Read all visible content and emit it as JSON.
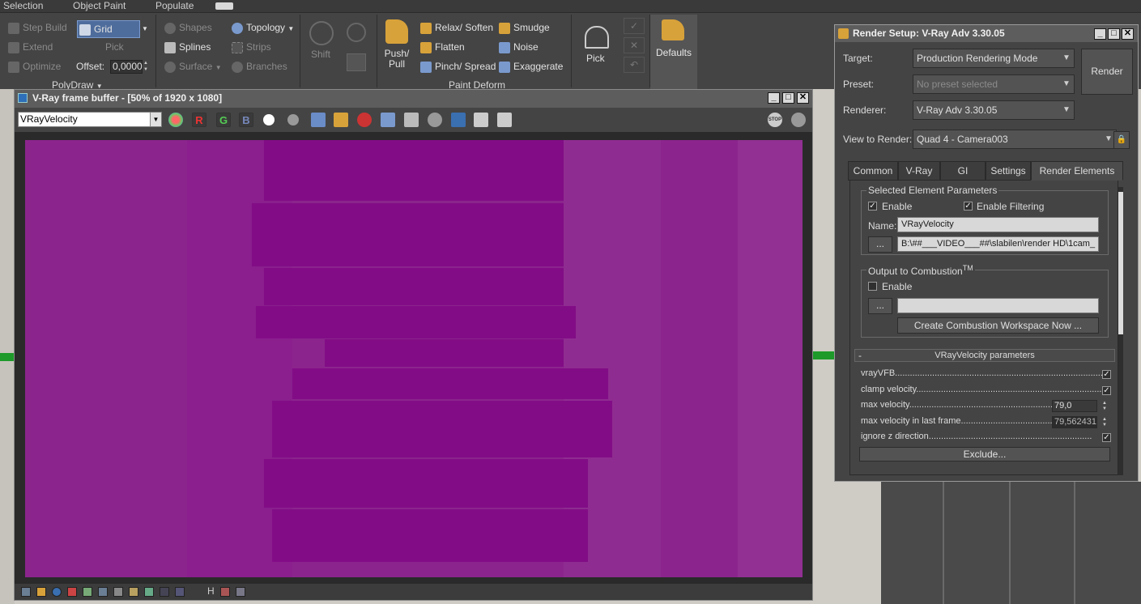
{
  "ribbon": {
    "tabs": [
      "Selection",
      "Object Paint",
      "Populate"
    ],
    "polymodeling": {
      "step_build": "Step Build",
      "extend": "Extend",
      "optimize": "Optimize",
      "grid": "Grid",
      "pick": "Pick",
      "offset_label": "Offset:",
      "offset_value": "0,0000",
      "group_title": "PolyDraw"
    },
    "draw": {
      "shapes": "Shapes",
      "splines": "Splines",
      "surface": "Surface",
      "topology": "Topology",
      "strips": "Strips",
      "branches": "Branches"
    },
    "shift": "Shift",
    "paint_deform": {
      "push_pull": "Push/\nPull",
      "relax_soften": "Relax/ Soften",
      "flatten": "Flatten",
      "pinch_spread": "Pinch/ Spread",
      "smudge": "Smudge",
      "noise": "Noise",
      "exaggerate": "Exaggerate",
      "group_title": "Paint Deform"
    },
    "pick": "Pick",
    "defaults": "Defaults"
  },
  "vfb": {
    "title": "V-Ray frame buffer - [50% of 1920 x 1080]",
    "channel": "VRayVelocity",
    "channel_buttons": [
      "R",
      "G",
      "B"
    ],
    "render_color": "#8c238e",
    "status_icons": [
      "H"
    ]
  },
  "render_setup": {
    "title": "Render Setup: V-Ray Adv 3.30.05",
    "target_label": "Target:",
    "target_value": "Production Rendering Mode",
    "preset_label": "Preset:",
    "preset_value": "No preset selected",
    "renderer_label": "Renderer:",
    "renderer_value": "V-Ray Adv 3.30.05",
    "view_label": "View to Render:",
    "view_value": "Quad 4 - Camera003",
    "render_button": "Render",
    "tabs": [
      "Common",
      "V-Ray",
      "GI",
      "Settings",
      "Render Elements"
    ],
    "selected_element": {
      "group_title": "Selected Element Parameters",
      "enable": "Enable",
      "enable_filtering": "Enable Filtering",
      "name_label": "Name:",
      "name_value": "VRayVelocity",
      "browse": "...",
      "path_value": "B:\\##___VIDEO___##\\slabilen\\render HD\\1cam_"
    },
    "combustion": {
      "group_title": "Output to Combustion",
      "tm": "TM",
      "enable": "Enable",
      "browse": "...",
      "path_value": "",
      "create_button": "Create Combustion Workspace Now ..."
    },
    "velocity_params": {
      "rollout_toggle": "-",
      "rollout_title": "VRayVelocity parameters",
      "rows": [
        {
          "label": "vrayVFB...........................................................................................",
          "type": "check",
          "checked": true
        },
        {
          "label": "clamp velocity............................................................................",
          "type": "check",
          "checked": true
        },
        {
          "label": "max velocity....................................................................",
          "type": "spin",
          "value": "79,0"
        },
        {
          "label": "max velocity in last frame.........................................",
          "type": "spin",
          "value": "79,562431"
        },
        {
          "label": "ignore z direction..................................................................",
          "type": "check",
          "checked": true
        }
      ],
      "exclude_button": "Exclude..."
    }
  }
}
